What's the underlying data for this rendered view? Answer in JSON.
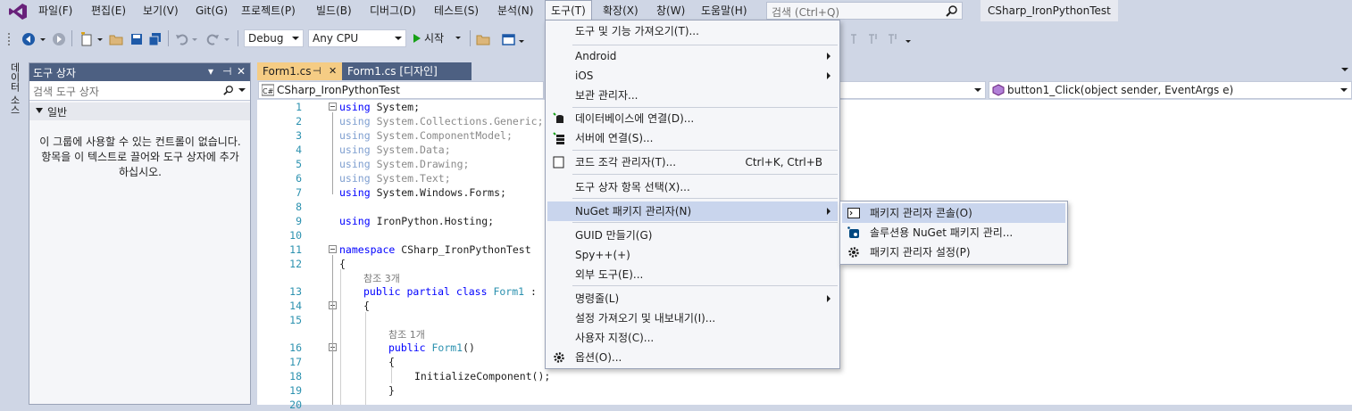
{
  "menubar": {
    "items": [
      "파일(F)",
      "편집(E)",
      "보기(V)",
      "Git(G)",
      "프로젝트(P)",
      "빌드(B)",
      "디버그(D)",
      "테스트(S)",
      "분석(N)",
      "도구(T)",
      "확장(X)",
      "창(W)",
      "도움말(H)"
    ],
    "search_placeholder": "검색 (Ctrl+Q)",
    "solution_title": "CSharp_IronPythonTest"
  },
  "toolbar": {
    "configuration": "Debug",
    "platform": "Any CPU",
    "start_label": "시작"
  },
  "side_tabs": [
    "데이터 소스"
  ],
  "toolbox": {
    "title": "도구 상자",
    "search_placeholder": "검색 도구 상자",
    "group": "일반",
    "empty_message": "이 그룹에 사용할 수 있는 컨트롤이 없습니다. 항목을 이 텍스트로 끌어와 도구 상자에 추가하십시오."
  },
  "doc_tabs": {
    "active": "Form1.cs",
    "inactive": "Form1.cs [디자인]"
  },
  "nav": {
    "project": "CSharp_IronPythonTest",
    "member": "button1_Click(object sender, EventArgs e)"
  },
  "code": {
    "line_numbers": [
      "1",
      "2",
      "3",
      "4",
      "5",
      "6",
      "7",
      "8",
      "9",
      "10",
      "11",
      "12",
      "13",
      "14",
      "15",
      "16",
      "17",
      "18",
      "19",
      "20"
    ],
    "ref_3": "참조 3개",
    "ref_1": "참조 1개",
    "using_kw": "using",
    "l1": "System;",
    "l2": "System.Collections.Generic;",
    "l3": "System.ComponentModel;",
    "l4": "System.Data;",
    "l5": "System.Drawing;",
    "l6": "System.Text;",
    "l7": "System.Windows.Forms;",
    "l9": "IronPython.Hosting;",
    "namespace_kw": "namespace",
    "l11": "CSharp_IronPythonTest",
    "brace_open": "{",
    "brace_close": "}",
    "public_kw": "public",
    "partial_kw": "partial",
    "class_kw": "class",
    "form_type": "Form1",
    "l13_tail": ":",
    "ctor_parens": "()",
    "l18": "InitializeComponent();"
  },
  "tools_menu": {
    "items": [
      {
        "label": "도구 및 기능 가져오기(T)...",
        "icon": "",
        "shortcut": "",
        "submenu": false
      },
      {
        "label": "Android",
        "icon": "",
        "shortcut": "",
        "submenu": true
      },
      {
        "label": "iOS",
        "icon": "",
        "shortcut": "",
        "submenu": true
      },
      {
        "label": "보관 관리자...",
        "icon": "",
        "shortcut": "",
        "submenu": false
      },
      {
        "label": "데이터베이스에 연결(D)...",
        "icon": "database-connect-icon",
        "shortcut": "",
        "submenu": false
      },
      {
        "label": "서버에 연결(S)...",
        "icon": "server-connect-icon",
        "shortcut": "",
        "submenu": false
      },
      {
        "label": "코드 조각 관리자(T)...",
        "icon": "snippet-icon",
        "shortcut": "Ctrl+K, Ctrl+B",
        "submenu": false
      },
      {
        "label": "도구 상자 항목 선택(X)...",
        "icon": "",
        "shortcut": "",
        "submenu": false
      },
      {
        "label": "NuGet 패키지 관리자(N)",
        "icon": "",
        "shortcut": "",
        "submenu": true
      },
      {
        "label": "GUID 만들기(G)",
        "icon": "",
        "shortcut": "",
        "submenu": false
      },
      {
        "label": "Spy++(+)",
        "icon": "",
        "shortcut": "",
        "submenu": false
      },
      {
        "label": "외부 도구(E)...",
        "icon": "",
        "shortcut": "",
        "submenu": false
      },
      {
        "label": "명령줄(L)",
        "icon": "",
        "shortcut": "",
        "submenu": true
      },
      {
        "label": "설정 가져오기 및 내보내기(I)...",
        "icon": "",
        "shortcut": "",
        "submenu": false
      },
      {
        "label": "사용자 지정(C)...",
        "icon": "",
        "shortcut": "",
        "submenu": false
      },
      {
        "label": "옵션(O)...",
        "icon": "gear-icon",
        "shortcut": "",
        "submenu": false
      }
    ]
  },
  "nuget_menu": {
    "items": [
      {
        "label": "패키지 관리자 콘솔(O)",
        "icon": "console-icon"
      },
      {
        "label": "솔루션용 NuGet 패키지 관리...",
        "icon": "nuget-icon"
      },
      {
        "label": "패키지 관리자 설정(P)",
        "icon": "gear-icon"
      }
    ]
  },
  "colors": {
    "chrome": "#cfd6e5",
    "accent": "#4d6082",
    "active_tab": "#f5cc84",
    "highlight": "#c9d5ed",
    "keyword": "#0000ff",
    "type": "#2b91af"
  }
}
